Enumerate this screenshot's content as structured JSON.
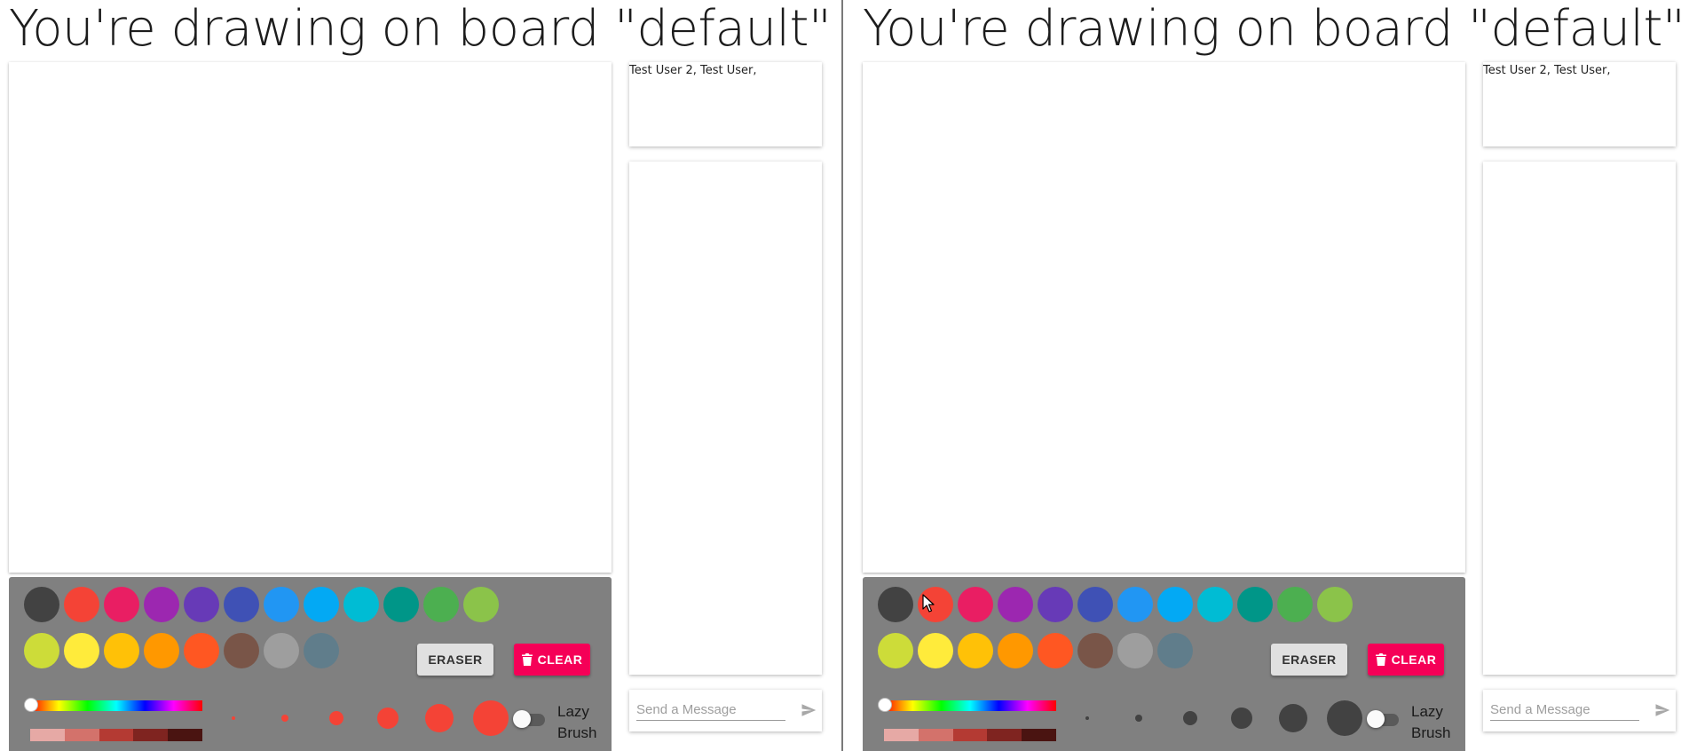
{
  "left": {
    "title": "You're drawing on board \"default\"",
    "users_text": "Test User 2, Test User,",
    "eraser_label": "ERASER",
    "clear_label": "CLEAR",
    "lazy_brush_label": "Lazy Brush",
    "message_placeholder": "Send a Message",
    "brush_color": "#f44336",
    "lazy_brush_enabled": false
  },
  "right": {
    "title": "You're drawing on board \"default\"",
    "users_text": "Test User 2, Test User,",
    "eraser_label": "ERASER",
    "clear_label": "CLEAR",
    "lazy_brush_label": "Lazy Brush",
    "message_placeholder": "Send a Message",
    "brush_color": "#424242",
    "lazy_brush_enabled": false
  },
  "palette": [
    "#424242",
    "#f44336",
    "#e91e63",
    "#9c27b0",
    "#673ab7",
    "#3f51b5",
    "#2196f3",
    "#03a9f4",
    "#00bcd4",
    "#009688",
    "#4caf50",
    "#8bc34a",
    "#cddc39",
    "#ffeb3b",
    "#ffc107",
    "#ff9800",
    "#ff5722",
    "#795548",
    "#9e9e9e",
    "#607d8b"
  ],
  "brush_sizes": [
    2,
    4,
    8,
    12,
    16,
    20
  ],
  "hue_value": 0,
  "shade_colors": [
    "#e6a9a5",
    "#d3726b",
    "#b43a33",
    "#7f2420",
    "#4a1411"
  ],
  "icons": {
    "clear": "trash-icon",
    "send": "send-icon",
    "cursor": "mouse-pointer-icon"
  }
}
